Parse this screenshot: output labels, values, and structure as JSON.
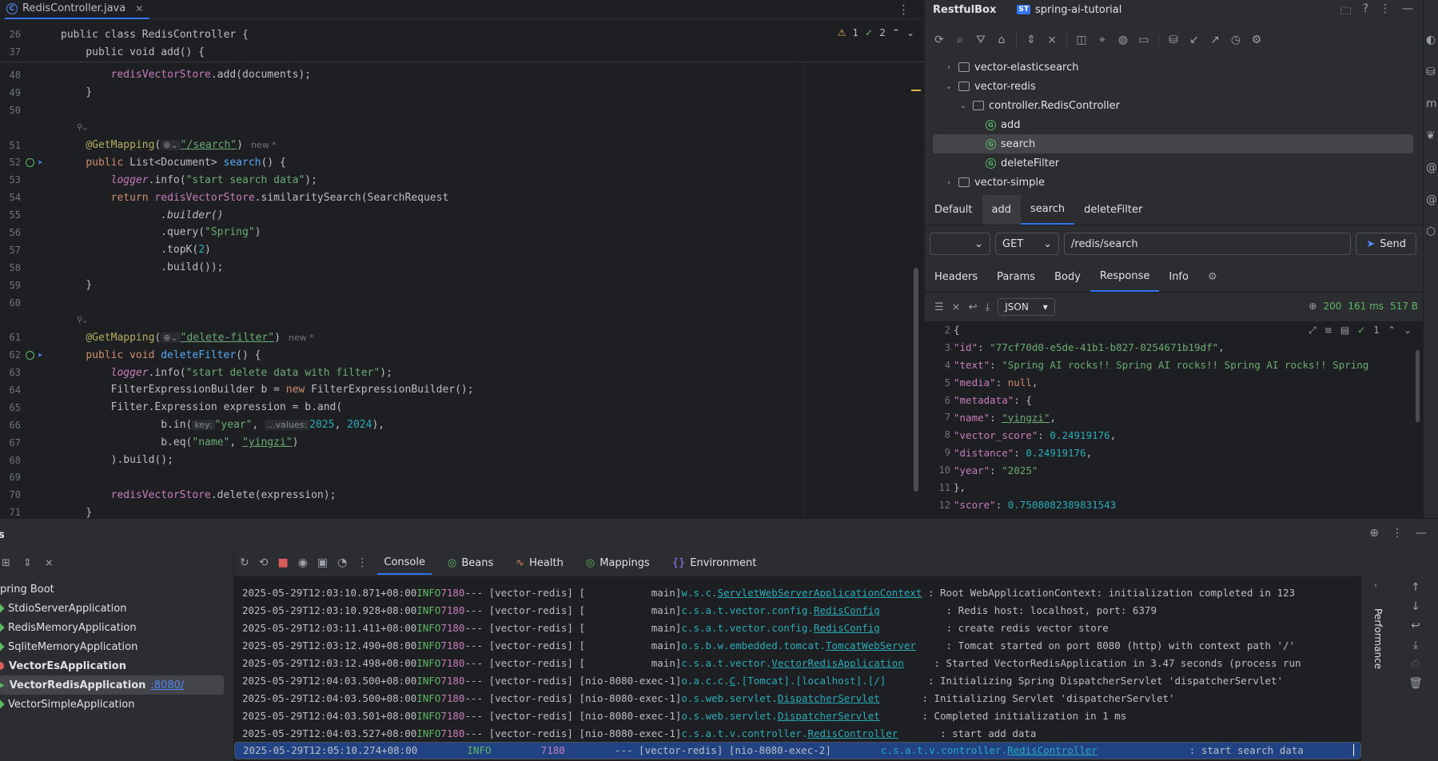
{
  "editor": {
    "tab_label": "RedisController.java",
    "tab_icon": "C",
    "menu_icon": "⋮",
    "inspections": {
      "warnings": "1",
      "checks": "2"
    },
    "sticky": [
      {
        "ln": "26",
        "code": "public class RedisController {"
      },
      {
        "ln": "37",
        "code": "    public void add() {"
      }
    ],
    "new_hint": "new *",
    "line_numbers": [
      "48",
      "49",
      "50",
      "",
      "51",
      "52",
      "53",
      "54",
      "55",
      "56",
      "57",
      "58",
      "59",
      "60",
      "",
      "61",
      "62",
      "63",
      "64",
      "65",
      "66",
      "67",
      "68",
      "69",
      "70",
      "71"
    ],
    "code": {
      "l48_field": "redisVectorStore",
      "l48_rest": ".add(documents);",
      "l51_anno": "@GetMapping",
      "l51_str": "\"/search\"",
      "l52_kw": "public",
      "l52_type": " List<Document> ",
      "l52_fn": "search",
      "l52_rest": "() {",
      "l53_field": "logger",
      "l53_mid": ".info(",
      "l53_str": "\"start search data\"",
      "l53_end": ");",
      "l54_kw": "return ",
      "l54_field": "redisVectorStore",
      "l54_rest": ".similaritySearch(SearchRequest",
      "l55": ".builder()",
      "l56_a": ".query(",
      "l56_str": "\"Spring\"",
      "l56_b": ")",
      "l57_a": ".topK(",
      "l57_num": "2",
      "l57_b": ")",
      "l58": ".build());",
      "l61_anno": "@GetMapping",
      "l61_str": "\"delete-filter\"",
      "l62_kw": "public void ",
      "l62_fn": "deleteFilter",
      "l62_rest": "() {",
      "l63_field": "logger",
      "l63_mid": ".info(",
      "l63_str": "\"start delete data with filter\"",
      "l63_end": ");",
      "l64_a": "FilterExpressionBuilder b = ",
      "l64_kw": "new",
      "l64_b": " FilterExpressionBuilder();",
      "l65": "Filter.Expression expression = b.and(",
      "l66_a": "b.in(",
      "l66_hint1": "key:",
      "l66_str": "\"year\"",
      "l66_hint2": "...values:",
      "l66_n1": "2025",
      "l66_n2": "2024",
      "l66_b": "),",
      "l67_a": "b.eq(",
      "l67_s1": "\"name\"",
      "l67_s2": "\"yingzi\"",
      "l67_b": ")",
      "l68": ").build();",
      "l70_field": "redisVectorStore",
      "l70_rest": ".delete(expression);",
      "brace": "}"
    }
  },
  "restful": {
    "title": "RestfulBox",
    "project_badge": "ST",
    "project": "spring-ai-tutorial",
    "tree": [
      {
        "label": "vector-elasticsearch",
        "level": 0,
        "chevron": "›"
      },
      {
        "label": "vector-redis",
        "level": 0,
        "chevron": "⌄"
      },
      {
        "label": "controller.RedisController",
        "level": 1,
        "chevron": "⌄"
      },
      {
        "label": "add",
        "level": 2,
        "method": true
      },
      {
        "label": "search",
        "level": 2,
        "method": true,
        "selected": true
      },
      {
        "label": "deleteFilter",
        "level": 2,
        "method": true
      },
      {
        "label": "vector-simple",
        "level": 0,
        "chevron": "›"
      }
    ],
    "req_tabs": [
      "Default",
      "add",
      "search",
      "deleteFilter"
    ],
    "method": "GET",
    "url": "/redis/search",
    "send": "Send",
    "resp_tabs": [
      "Headers",
      "Params",
      "Body",
      "Response",
      "Info"
    ],
    "format": "JSON",
    "status": "200",
    "time": "161 ms",
    "size": "517 B",
    "json_tools_count": "1",
    "json": {
      "ln": [
        "2",
        "3",
        "4",
        "5",
        "6",
        "7",
        "8",
        "9",
        "10",
        "11",
        "12"
      ],
      "brace_open": "{",
      "id_key": "\"id\"",
      "id_val": "\"77cf70d0-e5de-41b1-b827-0254671b19df\"",
      "text_key": "\"text\"",
      "text_val": "\"Spring AI rocks!! Spring AI rocks!! Spring AI rocks!! Spring",
      "media_key": "\"media\"",
      "media_val": "null",
      "meta_key": "\"metadata\"",
      "name_key": "\"name\"",
      "name_val": "\"yingzi\"",
      "vs_key": "\"vector_score\"",
      "vs_val": "0.24919176",
      "dist_key": "\"distance\"",
      "dist_val": "0.24919176",
      "year_key": "\"year\"",
      "year_val": "\"2025\"",
      "close": "},",
      "score_key": "\"score\"",
      "score_val": "0.7508082389831543"
    }
  },
  "services": {
    "title": "s",
    "items": [
      {
        "label": "pring Boot"
      },
      {
        "label": "StdioServerApplication"
      },
      {
        "label": "RedisMemoryApplication"
      },
      {
        "label": "SqliteMemoryApplication"
      },
      {
        "label": "VectorEsApplication"
      },
      {
        "label": "VectorRedisApplication",
        "port": ":8080/"
      },
      {
        "label": "VectorSimpleApplication"
      }
    ],
    "tabs": [
      "Console",
      "Beans",
      "Health",
      "Mappings",
      "Environment"
    ],
    "perf_label": "Performance",
    "logs": [
      {
        "ts": "2025-05-29T12:03:10.871+08:00",
        "lvl": "INFO",
        "pid": "7180",
        "thread": "--- [vector-redis] [           main]",
        "logger_pre": "w.s.c.",
        "logger_u": "ServletWebServerApplicationContext",
        "logger_post": "",
        "msg": " : Root WebApplicationContext: initialization completed in 123"
      },
      {
        "ts": "2025-05-29T12:03:10.928+08:00",
        "lvl": "INFO",
        "pid": "7180",
        "thread": "--- [vector-redis] [           main]",
        "logger_pre": "c.s.a.t.vector.config.",
        "logger_u": "RedisConfig",
        "logger_post": "          ",
        "msg": " : Redis host: localhost, port: 6379"
      },
      {
        "ts": "2025-05-29T12:03:11.411+08:00",
        "lvl": "INFO",
        "pid": "7180",
        "thread": "--- [vector-redis] [           main]",
        "logger_pre": "c.s.a.t.vector.config.",
        "logger_u": "RedisConfig",
        "logger_post": "          ",
        "msg": " : create redis vector store"
      },
      {
        "ts": "2025-05-29T12:03:12.490+08:00",
        "lvl": "INFO",
        "pid": "7180",
        "thread": "--- [vector-redis] [           main]",
        "logger_pre": "o.s.b.w.embedded.tomcat.",
        "logger_u": "TomcatWebServer",
        "logger_post": "    ",
        "msg": " : Tomcat started on port 8080 (http) with context path '/'"
      },
      {
        "ts": "2025-05-29T12:03:12.498+08:00",
        "lvl": "INFO",
        "pid": "7180",
        "thread": "--- [vector-redis] [           main]",
        "logger_pre": "c.s.a.t.vector.",
        "logger_u": "VectorRedisApplication",
        "logger_post": "    ",
        "msg": " : Started VectorRedisApplication in 3.47 seconds (process run"
      },
      {
        "ts": "2025-05-29T12:04:03.500+08:00",
        "lvl": "INFO",
        "pid": "7180",
        "thread": "--- [vector-redis] [nio-8080-exec-1]",
        "logger_pre": "o.a.c.c.",
        "logger_u": "C",
        "logger_post": ".[Tomcat].[localhost].[/]      ",
        "msg": " : Initializing Spring DispatcherServlet 'dispatcherServlet'"
      },
      {
        "ts": "2025-05-29T12:04:03.500+08:00",
        "lvl": "INFO",
        "pid": "7180",
        "thread": "--- [vector-redis] [nio-8080-exec-1]",
        "logger_pre": "o.s.web.servlet.",
        "logger_u": "DispatcherServlet",
        "logger_post": "      ",
        "msg": " : Initializing Servlet 'dispatcherServlet'"
      },
      {
        "ts": "2025-05-29T12:04:03.501+08:00",
        "lvl": "INFO",
        "pid": "7180",
        "thread": "--- [vector-redis] [nio-8080-exec-1]",
        "logger_pre": "o.s.web.servlet.",
        "logger_u": "DispatcherServlet",
        "logger_post": "      ",
        "msg": " : Completed initialization in 1 ms"
      },
      {
        "ts": "2025-05-29T12:04:03.527+08:00",
        "lvl": "INFO",
        "pid": "7180",
        "thread": "--- [vector-redis] [nio-8080-exec-1]",
        "logger_pre": "c.s.a.t.v.controller.",
        "logger_u": "RedisController",
        "logger_post": "      ",
        "msg": " : start add data"
      },
      {
        "ts": "2025-05-29T12:05:10.274+08:00",
        "lvl": "INFO",
        "pid": "7180",
        "thread": "--- [vector-redis] [nio-8080-exec-2]",
        "logger_pre": "c.s.a.t.v.controller.",
        "logger_u": "RedisController",
        "logger_post": "      ",
        "msg": " : start search data"
      }
    ]
  }
}
